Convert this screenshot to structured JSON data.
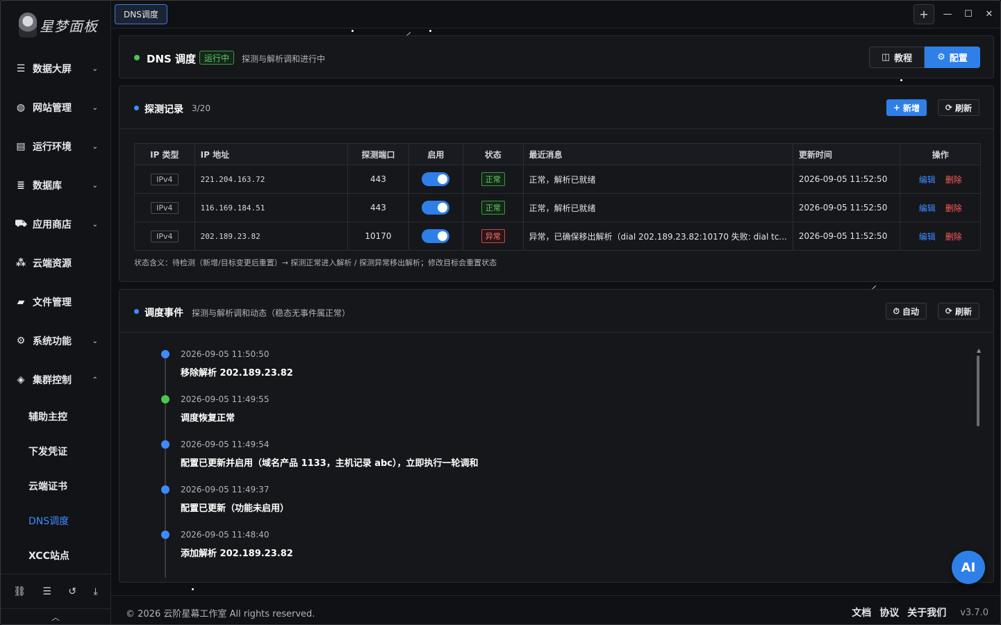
{
  "app": {
    "logo_text": "星梦面板"
  },
  "sidebar": {
    "items": [
      {
        "label": "数据大屏",
        "icon": "dashboard-icon",
        "chevron": "⌄"
      },
      {
        "label": "网站管理",
        "icon": "globe-icon",
        "chevron": "⌄"
      },
      {
        "label": "运行环境",
        "icon": "server-icon",
        "chevron": "⌄"
      },
      {
        "label": "数据库",
        "icon": "database-icon",
        "chevron": "⌄"
      },
      {
        "label": "应用商店",
        "icon": "cart-icon",
        "chevron": "⌄"
      },
      {
        "label": "云端资源",
        "icon": "cubes-icon",
        "chevron": ""
      },
      {
        "label": "文件管理",
        "icon": "folder-icon",
        "chevron": ""
      },
      {
        "label": "系统功能",
        "icon": "gears-icon",
        "chevron": "⌄"
      },
      {
        "label": "集群控制",
        "icon": "layers-icon",
        "chevron": "⌃"
      }
    ],
    "subitems": [
      {
        "label": "辅助主控",
        "active": false
      },
      {
        "label": "下发凭证",
        "active": false
      },
      {
        "label": "云端证书",
        "active": false
      },
      {
        "label": "DNS调度",
        "active": true
      },
      {
        "label": "XCC站点",
        "active": false
      }
    ],
    "footer_icons": [
      "share-icon",
      "list-icon",
      "history-icon",
      "download-icon"
    ]
  },
  "topbar": {
    "tab_label": "DNS调度",
    "plus": "+",
    "minimize": "—",
    "maximize": "☐",
    "close": "✕"
  },
  "header": {
    "title": "DNS 调度",
    "status_badge": "运行中",
    "description": "探测与解析调和进行中",
    "tutorial_label": "教程",
    "config_label": "配置"
  },
  "records": {
    "title": "探测记录",
    "count": "3/20",
    "add_label": "新增",
    "refresh_label": "刷新",
    "columns": [
      "IP 类型",
      "IP 地址",
      "探测端口",
      "启用",
      "状态",
      "最近消息",
      "更新时间",
      "操作"
    ],
    "rows": [
      {
        "type": "IPv4",
        "ip": "221.204.163.72",
        "port": "443",
        "enabled": true,
        "status": "正常",
        "status_ok": true,
        "message": "正常，解析已就绪",
        "updated": "2026-09-05 11:52:50",
        "edit": "编辑",
        "delete": "删除"
      },
      {
        "type": "IPv4",
        "ip": "116.169.184.51",
        "port": "443",
        "enabled": true,
        "status": "正常",
        "status_ok": true,
        "message": "正常，解析已就绪",
        "updated": "2026-09-05 11:52:50",
        "edit": "编辑",
        "delete": "删除"
      },
      {
        "type": "IPv4",
        "ip": "202.189.23.82",
        "port": "10170",
        "enabled": true,
        "status": "异常",
        "status_ok": false,
        "message": "异常，已确保移出解析（dial 202.189.23.82:10170 失败: dial tc...",
        "updated": "2026-09-05 11:52:50",
        "edit": "编辑",
        "delete": "删除"
      }
    ],
    "note": "状态含义：待检测（新增/目标变更后重置）→ 探测正常进入解析 / 探测异常移出解析；修改目标会重置状态"
  },
  "events": {
    "title": "调度事件",
    "subtitle": "探测与解析调和动态（稳态无事件属正常）",
    "auto_label": "自动",
    "refresh_label": "刷新",
    "items": [
      {
        "time": "2026-09-05 11:50:50",
        "message": "移除解析 202.189.23.82",
        "color": "#3d8bff"
      },
      {
        "time": "2026-09-05 11:49:55",
        "message": "调度恢复正常",
        "color": "#4cc552"
      },
      {
        "time": "2026-09-05 11:49:54",
        "message": "配置已更新并启用（域名产品 1133，主机记录 abc），立即执行一轮调和",
        "color": "#3d8bff"
      },
      {
        "time": "2026-09-05 11:49:37",
        "message": "配置已更新（功能未启用）",
        "color": "#3d8bff"
      },
      {
        "time": "2026-09-05 11:48:40",
        "message": "添加解析 202.189.23.82",
        "color": "#3d8bff"
      }
    ]
  },
  "ai_button": "AI",
  "footer": {
    "copyright": "© 2026 云阶星幕工作室 All rights reserved.",
    "links": [
      "文档",
      "协议",
      "关于我们"
    ],
    "version": "v3.7.0"
  }
}
